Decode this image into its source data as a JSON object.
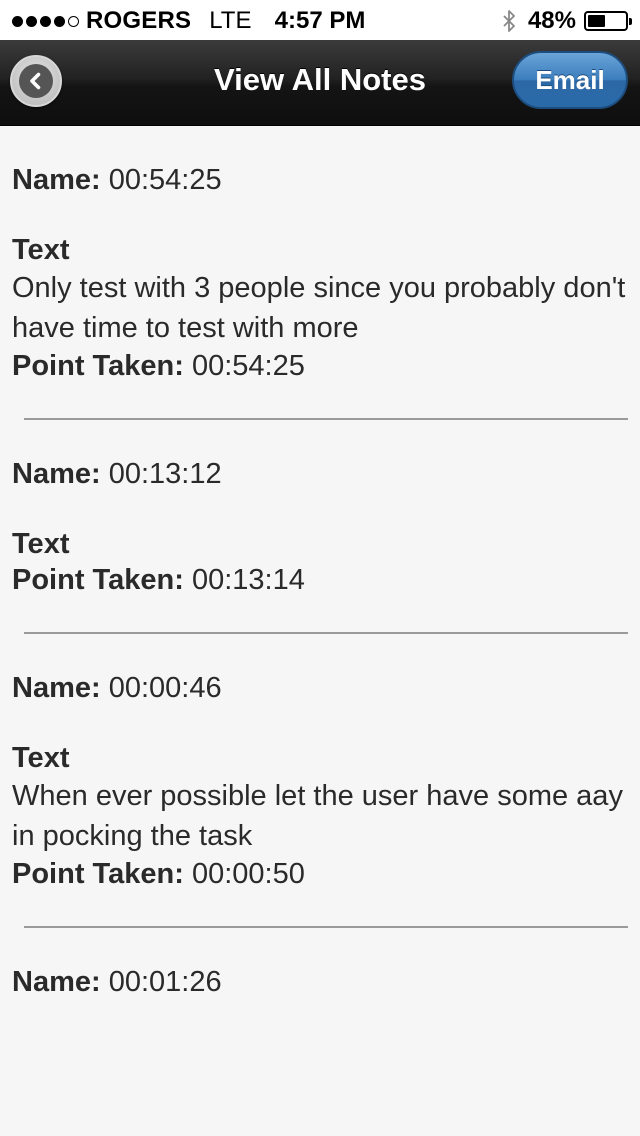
{
  "status_bar": {
    "carrier": "ROGERS",
    "network": "LTE",
    "time": "4:57 PM",
    "battery_percent": "48%",
    "battery_level": 0.48,
    "signal_bars": 4,
    "signal_total": 5
  },
  "header": {
    "title": "View All Notes",
    "email_label": "Email",
    "email_color": "#3b7dbd"
  },
  "labels": {
    "name": "Name:",
    "text": "Text",
    "point_taken": "Point Taken:"
  },
  "notes": [
    {
      "name": "00:54:25",
      "text": "Only test with 3 people since you probably don't have time to test with more",
      "point_taken": "00:54:25"
    },
    {
      "name": "00:13:12",
      "text": "",
      "point_taken": "00:13:14"
    },
    {
      "name": "00:00:46",
      "text": "When ever possible let the user have some aay in pocking the task",
      "point_taken": "00:00:50"
    },
    {
      "name": "00:01:26",
      "text": "",
      "point_taken": ""
    }
  ]
}
